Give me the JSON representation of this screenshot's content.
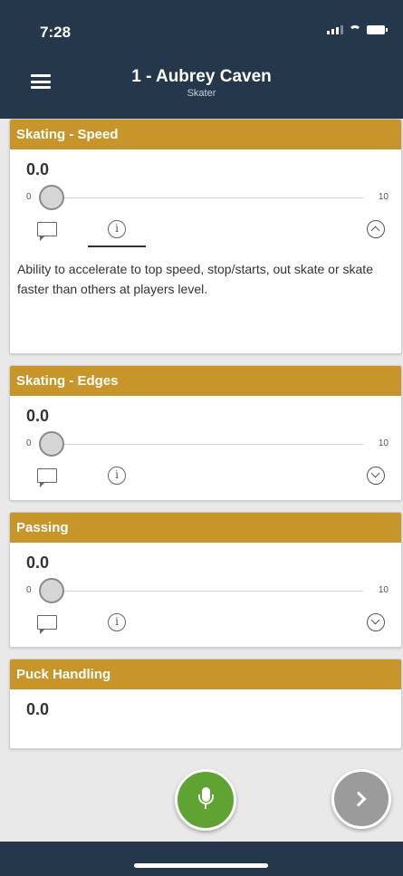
{
  "status_bar": {
    "time": "7:28"
  },
  "header": {
    "title": "1 - Aubrey Caven",
    "subtitle": "Skater"
  },
  "cards": [
    {
      "title": "Skating - Speed",
      "value": "0.0",
      "min": "0",
      "max": "10",
      "expanded": true,
      "description": "Ability to accelerate to top speed, stop/starts, out skate or skate faster than others at players level."
    },
    {
      "title": "Skating - Edges",
      "value": "0.0",
      "min": "0",
      "max": "10",
      "expanded": false
    },
    {
      "title": "Passing",
      "value": "0.0",
      "min": "0",
      "max": "10",
      "expanded": false
    },
    {
      "title": "Puck Handling",
      "value": "0.0"
    }
  ],
  "colors": {
    "header_bg": "#25374b",
    "card_header_bg": "#c8952a",
    "mic_button": "#5fa432",
    "next_button": "#9b9b9b"
  },
  "icons": {
    "menu": "hamburger-icon",
    "comment": "comment-icon",
    "info": "info-icon",
    "collapse": "chevron-up-icon",
    "expand": "chevron-down-icon",
    "mic": "microphone-icon",
    "next": "chevron-right-icon"
  }
}
